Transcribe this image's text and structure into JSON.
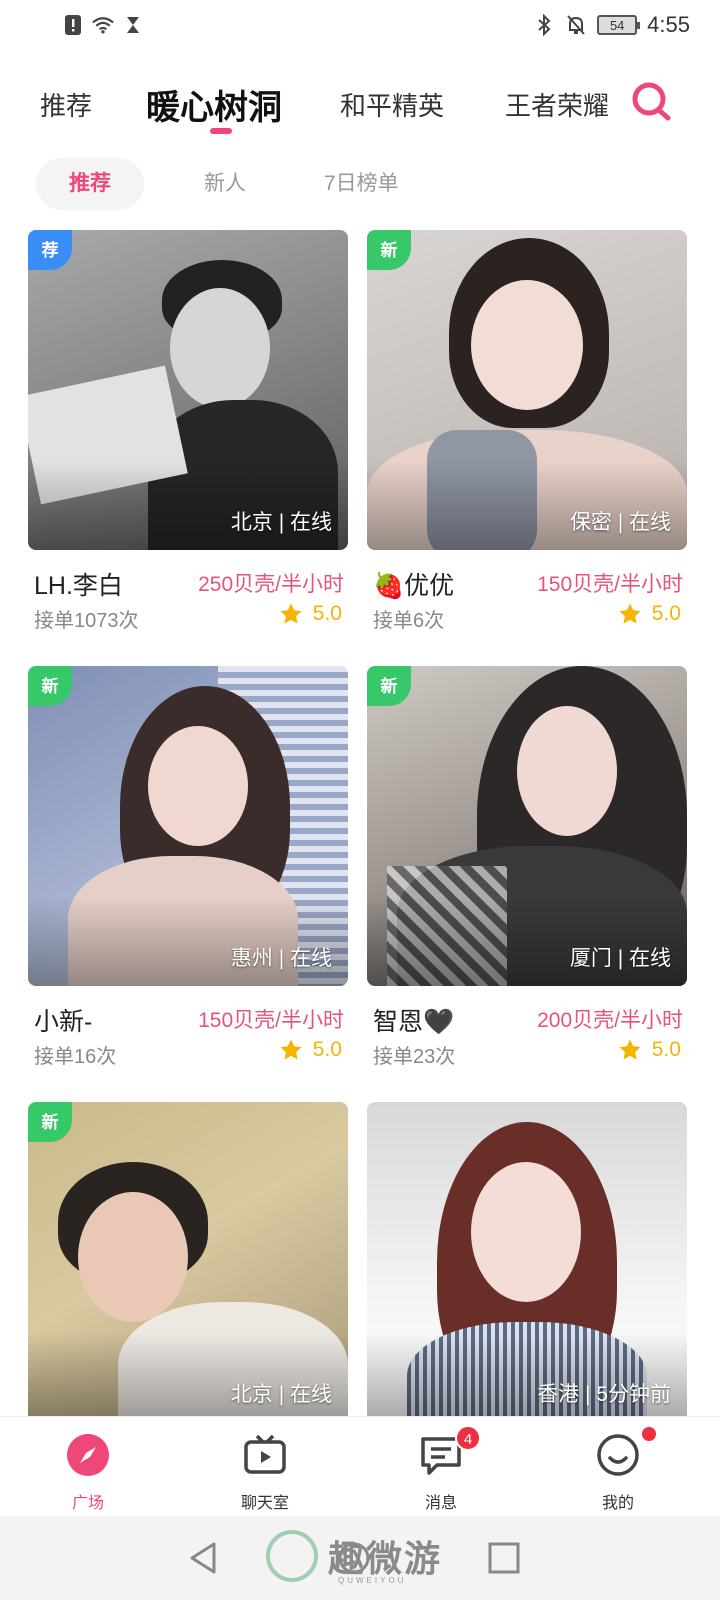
{
  "status_bar": {
    "time": "4:55",
    "battery": "54",
    "left_icons": [
      "alert-icon",
      "wifi-icon",
      "hourglass-icon"
    ],
    "right_icons": [
      "bluetooth-icon",
      "mute-bell-icon"
    ]
  },
  "top_tabs": [
    {
      "label": "推荐"
    },
    {
      "label": "暖心树洞",
      "active": true
    },
    {
      "label": "和平精英"
    },
    {
      "label": "王者荣耀"
    }
  ],
  "sub_tabs": [
    {
      "label": "推荐",
      "active": true
    },
    {
      "label": "新人"
    },
    {
      "label": "7日榜单"
    }
  ],
  "cards": [
    {
      "badge": "荐",
      "badge_type": "recommend",
      "location": "北京 | 在线",
      "name": "LH.李白",
      "price": "250贝壳/半小时",
      "orders": "接单1073次",
      "rating": "5.0"
    },
    {
      "badge": "新",
      "badge_type": "new",
      "location": "保密 | 在线",
      "name": "🍓优优",
      "price": "150贝壳/半小时",
      "orders": "接单6次",
      "rating": "5.0"
    },
    {
      "badge": "新",
      "badge_type": "new",
      "location": "惠州 | 在线",
      "name": "小新-",
      "price": "150贝壳/半小时",
      "orders": "接单16次",
      "rating": "5.0"
    },
    {
      "badge": "新",
      "badge_type": "new",
      "location": "厦门 | 在线",
      "name": "智恩🖤",
      "price": "200贝壳/半小时",
      "orders": "接单23次",
      "rating": "5.0"
    },
    {
      "badge": "新",
      "badge_type": "new",
      "location": "北京 | 在线",
      "name": "",
      "price": "",
      "orders": "",
      "rating": ""
    },
    {
      "badge": "",
      "badge_type": "",
      "location": "香港 | 5分钟前",
      "name": "",
      "price": "",
      "orders": "",
      "rating": ""
    }
  ],
  "bottom_nav": [
    {
      "label": "广场",
      "icon": "compass-icon",
      "active": true
    },
    {
      "label": "聊天室",
      "icon": "tv-icon"
    },
    {
      "label": "消息",
      "icon": "message-icon",
      "badge": "4"
    },
    {
      "label": "我的",
      "icon": "smile-icon",
      "dot": true
    }
  ],
  "watermark": {
    "text": "趣微游",
    "sub": "QUWEIYOU"
  },
  "colors": {
    "accent": "#f0477a",
    "price": "#e8517e",
    "star": "#f5b400",
    "new_badge": "#37c86a",
    "recommend_badge": "#3a8df5"
  }
}
